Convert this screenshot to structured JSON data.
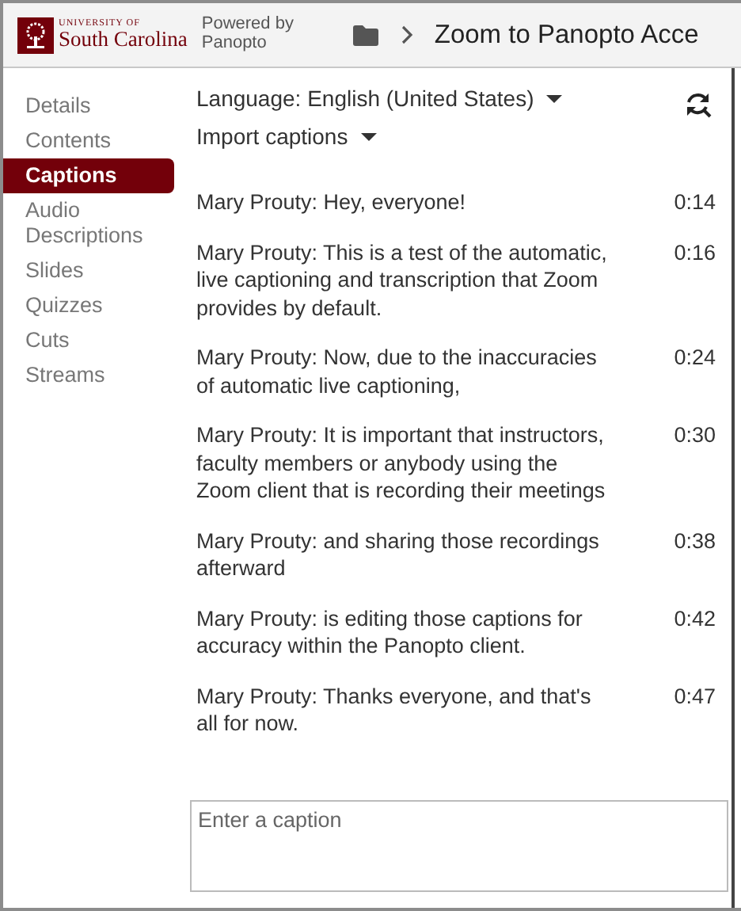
{
  "header": {
    "brand_small": "UNIVERSITY OF",
    "brand_name": "South Carolina",
    "powered_by": "Powered by Panopto",
    "title": "Zoom to Panopto Acce"
  },
  "sidebar": {
    "items": [
      {
        "label": "Details",
        "selected": false
      },
      {
        "label": "Contents",
        "selected": false
      },
      {
        "label": "Captions",
        "selected": true
      },
      {
        "label": "Audio Descriptions",
        "selected": false
      },
      {
        "label": "Slides",
        "selected": false
      },
      {
        "label": "Quizzes",
        "selected": false
      },
      {
        "label": "Cuts",
        "selected": false
      },
      {
        "label": "Streams",
        "selected": false
      }
    ]
  },
  "language": "Language: English (United States)",
  "import": "Import captions",
  "captions": [
    {
      "text": "Mary Prouty: Hey, everyone!",
      "time": "0:14"
    },
    {
      "text": "Mary Prouty: This is a test of the automatic, live captioning and transcription that Zoom provides by default.",
      "time": "0:16"
    },
    {
      "text": "Mary Prouty: Now, due to the inaccuracies of automatic live captioning,",
      "time": "0:24"
    },
    {
      "text": "Mary Prouty: It is important that instructors, faculty members or anybody using the Zoom client that is recording their meetings",
      "time": "0:30"
    },
    {
      "text": "Mary Prouty: and sharing those recordings afterward",
      "time": "0:38"
    },
    {
      "text": "Mary Prouty: is editing those captions for accuracy within the Panopto client.",
      "time": "0:42"
    },
    {
      "text": "Mary Prouty: Thanks everyone, and that's all for now.",
      "time": "0:47"
    }
  ],
  "caption_input": {
    "placeholder": "Enter a caption"
  }
}
